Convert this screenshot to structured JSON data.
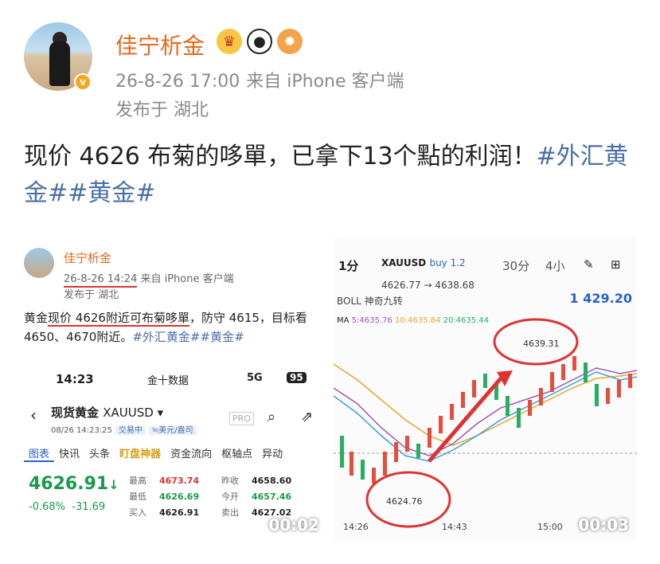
{
  "post": {
    "username": "佳宁析金",
    "verified_badge": "v",
    "emoji_icons": [
      "crown-icon",
      "panda-icon",
      "pufferfish-icon"
    ],
    "date": "26-8-26 17:00",
    "source": "来自 iPhone 客户端",
    "location": "发布于 湖北",
    "text": "现价 4626 布菊的哆單，已拿下13个點的利润！",
    "tags": [
      "#外汇黄金#",
      "#黄金#"
    ]
  },
  "video1": {
    "name": "佳宁析金",
    "date": "26-8-26 14:24",
    "source": "来自 iPhone 客户端",
    "location": "发布于 湖北",
    "line1_prefix": "黄金",
    "line1_highlight": "现价 4626附近可布菊哆單",
    "line1_suffix": "，防守 4615，目标看",
    "line2": "4650、4670附近。",
    "line2_tags": "#外汇黄金##黄金#",
    "status_time": "14:23",
    "status_app": "金十数据",
    "status_signal": "5G",
    "status_battery": "95",
    "quote_title": "现货黄金",
    "quote_symbol": "XAUUSD ▾",
    "quote_time": "08/26 14:23:25",
    "quote_state": "交易中",
    "quote_unit": "≒美元/盎司",
    "pro_label": "PRO",
    "tabs": [
      "图表",
      "快讯",
      "头条",
      "盯盘神器",
      "资金流向",
      "枢轴点",
      "异动"
    ],
    "price": "4626.91",
    "price_arrow": "↓",
    "change_pct": "-0.68%",
    "change_val": "-31.69",
    "stats": [
      {
        "l1": "最高",
        "v1": "4673.74",
        "c1": "red",
        "l2": "昨收",
        "v2": "4658.60",
        "c2": ""
      },
      {
        "l1": "最低",
        "v1": "4626.69",
        "c1": "grn",
        "l2": "今开",
        "v2": "4657.46",
        "c2": "grn"
      },
      {
        "l1": "买入",
        "v1": "4626.91",
        "c1": "",
        "l2": "卖出",
        "v2": "4627.02",
        "c2": ""
      }
    ],
    "duration": "00:02"
  },
  "video2": {
    "timeframe_active": "1分",
    "timeframe_other1": "30分",
    "timeframe_other2": "4小",
    "symbol": "XAUUSD",
    "buy": "buy 1.2",
    "range": "4626.77 → 4638.68",
    "indicators": "BOLL  神奇九转",
    "balance": "1 429.20",
    "ma_label": "MA",
    "ma5": "5:4635.76",
    "ma10": "10:4635.84",
    "ma20": "20:4635.44",
    "high_label": "4639.31",
    "low_label": "4624.76",
    "x_ticks": [
      "14:26",
      "14:43",
      "15:00"
    ],
    "duration": "00:03"
  }
}
